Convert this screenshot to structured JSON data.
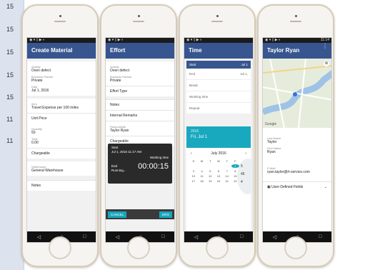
{
  "left_numbers": [
    "15",
    "15",
    "15",
    "15",
    "15",
    "11",
    "11"
  ],
  "phones": {
    "p1": {
      "status_time": "",
      "title": "Create Material",
      "fields": [
        {
          "label": "Activity",
          "value": "Oven defect"
        },
        {
          "label": "Business Partner",
          "value": "Private"
        },
        {
          "label": "Date",
          "value": "Jul 1, 2016"
        }
      ],
      "item": {
        "label": "Item",
        "value": "Travel Expense per 100 miles"
      },
      "unit_price": "Unit Price",
      "quantity": {
        "label": "Quantity",
        "value": "50"
      },
      "total": {
        "label": "Total",
        "value": "0.00"
      },
      "chargeable": "Chargeable",
      "warehouse": {
        "label": "Warehouse",
        "value": "General Warehouse"
      },
      "notes": "Notes"
    },
    "p2": {
      "title": "Effort",
      "fields": [
        {
          "label": "Activity",
          "value": "Oven defect"
        },
        {
          "label": "Business Partner",
          "value": "Private"
        }
      ],
      "effort_type": "Effort Type",
      "notes": "Notes",
      "internal_remarks": "Internal Remarks",
      "responsible": {
        "label": "Responsible",
        "value": "Taylor Ryan"
      },
      "chargeable": "Chargeable",
      "overlay": {
        "start_label": "Start",
        "start_value": "Jul 1, 2016 11:17 AM",
        "working_time_label": "Working time",
        "timer": "00:00:15",
        "end_label": "End",
        "end_value": "Running..."
      },
      "cancel": "CANCEL",
      "right_button": "DRO"
    },
    "p3": {
      "title": "Time",
      "start_label": "Start",
      "start_value": "Jul 1",
      "end_label": "End",
      "end_value": "Jul 1,",
      "break": "Break",
      "working_time": "Working time",
      "repeat": "Repeat",
      "year": "2016",
      "date": "Fri, Jul 1",
      "month": "July 2016",
      "weekdays": [
        "S",
        "M",
        "T",
        "W",
        "T",
        "F",
        "S"
      ],
      "days": [
        "",
        "",
        "",
        "",
        "",
        "1",
        "2",
        "3",
        "4",
        "5",
        "6",
        "7",
        "8",
        "9",
        "10",
        "11",
        "12",
        "13",
        "14",
        "15",
        "16",
        "17",
        "18",
        "19",
        "20",
        "21",
        "22",
        "23"
      ],
      "clock_values": [
        "5",
        "45",
        "4"
      ]
    },
    "p4": {
      "title": "Taylor Ryan",
      "status_time": "11:14",
      "map_label": "Google",
      "last_name": {
        "label": "Last Name",
        "value": "Taylor"
      },
      "first_name": {
        "label": "First Name",
        "value": "Ryan"
      },
      "email": {
        "label": "E-Mail",
        "value": "ryan.taylor@rt-service.com"
      },
      "udf": "User-Defined Fields"
    }
  },
  "icons": {
    "back": "back-icon",
    "home": "home-icon",
    "recent": "recent-apps-icon"
  },
  "colors": {
    "appbar": "#37558f",
    "accent": "#19a9bf"
  }
}
